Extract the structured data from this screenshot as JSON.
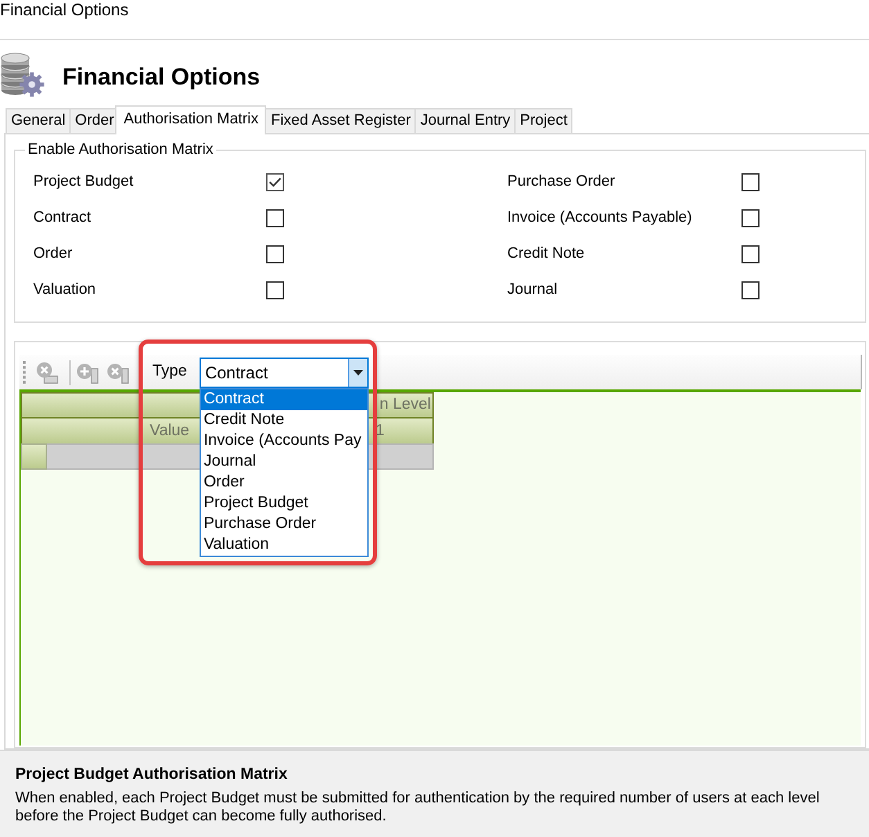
{
  "window": {
    "title": "Financial Options"
  },
  "header": {
    "title": "Financial Options"
  },
  "tabs": [
    {
      "label": "General",
      "selected": false
    },
    {
      "label": "Order",
      "selected": false
    },
    {
      "label": "Authorisation Matrix",
      "selected": true
    },
    {
      "label": "Fixed Asset Register",
      "selected": false
    },
    {
      "label": "Journal Entry",
      "selected": false
    },
    {
      "label": "Project",
      "selected": false
    }
  ],
  "enable_group": {
    "title": "Enable Authorisation Matrix",
    "options": [
      {
        "label": "Project Budget",
        "checked": true
      },
      {
        "label": "Purchase Order",
        "checked": false
      },
      {
        "label": "Contract",
        "checked": false
      },
      {
        "label": "Invoice (Accounts Payable)",
        "checked": false
      },
      {
        "label": "Order",
        "checked": false
      },
      {
        "label": "Credit Note",
        "checked": false
      },
      {
        "label": "Valuation",
        "checked": false
      },
      {
        "label": "Journal",
        "checked": false
      }
    ]
  },
  "toolbar": {
    "button_groups": [
      {
        "buttons": [
          {
            "kind": "cross-below",
            "disabled": true
          }
        ]
      },
      {
        "buttons": [
          {
            "kind": "plus-side",
            "disabled": true
          },
          {
            "kind": "cross-side",
            "disabled": true
          }
        ]
      }
    ],
    "type_filter": {
      "label": "Type",
      "value": "Contract",
      "expanded": true,
      "options": [
        {
          "label": "Contract",
          "selected": true
        },
        {
          "label": "Credit Note",
          "selected": false
        },
        {
          "label": "Invoice (Accounts Pay",
          "selected": false
        },
        {
          "label": "Journal",
          "selected": false
        },
        {
          "label": "Order",
          "selected": false
        },
        {
          "label": "Project Budget",
          "selected": false
        },
        {
          "label": "Purchase Order",
          "selected": false
        },
        {
          "label": "Valuation",
          "selected": false
        }
      ]
    }
  },
  "grid": {
    "column_group": "n Level",
    "columns": [
      {
        "label": "Value"
      },
      {
        "label": "1"
      }
    ]
  },
  "help": {
    "title": "Project Budget Authorisation Matrix",
    "text": "When enabled, each Project Budget must be submitted for authentication by the required number of users at each level before the Project Budget can become fully authorised."
  }
}
